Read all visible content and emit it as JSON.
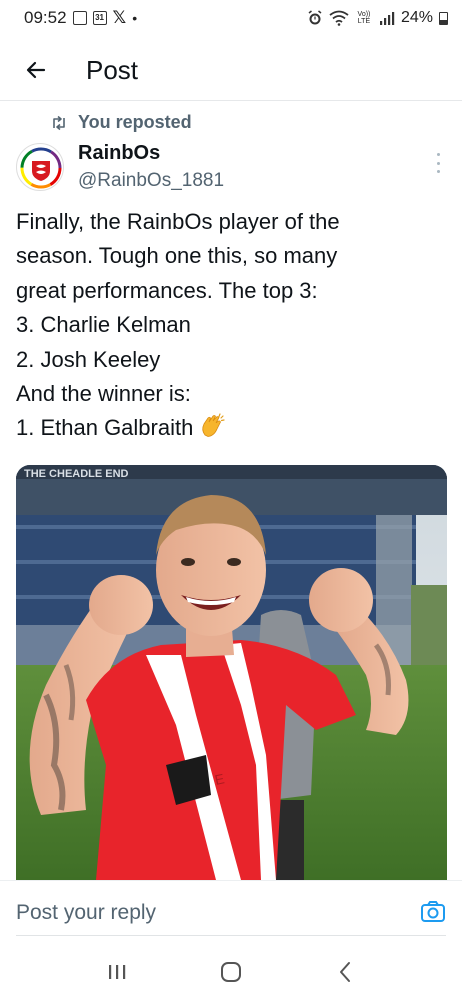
{
  "status_bar": {
    "time": "09:52",
    "icons": [
      "gallery-icon",
      "calendar-icon",
      "x-logo-icon",
      "dot-icon"
    ],
    "calendar_day": "31",
    "right_icons": [
      "alarm-icon",
      "wifi-icon",
      "volte-icon",
      "signal-icon"
    ],
    "volte_text": "Vo)) LTE",
    "battery": "24%"
  },
  "header": {
    "title": "Post",
    "back_icon": "arrow-left-icon"
  },
  "post": {
    "repost_label": "You reposted",
    "author_name": "RainbOs",
    "author_handle": "@RainbOs_1881",
    "text_lines": [
      "Finally, the RainbOs player of the",
      "season. Tough one this,  so many",
      "great performances. The top 3:",
      "3. Charlie Kelman",
      "2. Josh Keeley",
      "And the winner is:",
      "1. Ethan Galbraith"
    ],
    "emoji": "clapping-hands-icon",
    "stadium_sign": "THE CHEADLE END"
  },
  "reply": {
    "placeholder": "Post your reply",
    "camera_icon": "camera-icon"
  },
  "nav": {
    "recents_icon": "recents-icon",
    "home_icon": "home-icon",
    "back_icon": "nav-back-icon"
  },
  "colors": {
    "text_primary": "#0f1419",
    "text_secondary": "#536471",
    "accent": "#1d9bf0",
    "shirt_red": "#e8242b"
  }
}
